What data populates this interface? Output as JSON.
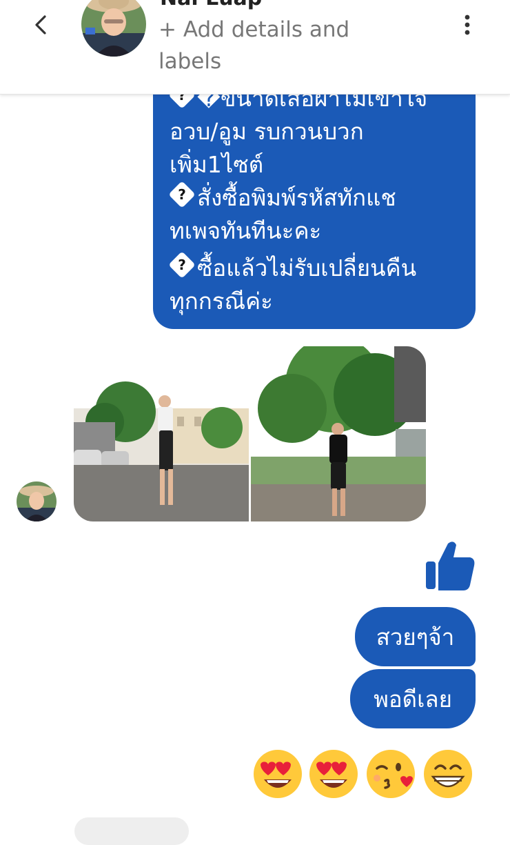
{
  "header": {
    "contact_name": "Nal Luap",
    "add_details": "+ Add details and labels"
  },
  "icons": {
    "back": "chevron-left-icon",
    "more": "more-vertical-icon",
    "like": "thumbs-up-icon"
  },
  "colors": {
    "bubble": "#1B5AB7",
    "like": "#1B5AB7",
    "header_text": "#777777"
  },
  "messages": {
    "outgoing_long": {
      "lines": [
        "�ขนาดเสื้อผ้าไม่เข้าใจ",
        "อวบ/อูม รบกวนบวก",
        "เพิ่ม1ไซต์",
        "สั่งซื้อพิมพ์รหัสทักแช",
        "ทเพจทันทีนะคะ",
        "ซื้อแล้วไม่รับเปลี่ยนคืน",
        "ทุกกรณีค่ะ"
      ]
    },
    "incoming_photos": [
      "photo-standing-parking-lot",
      "photo-standing-under-tree"
    ],
    "reply_1": "สวยๆจ้า",
    "reply_2": "พอดีเลย",
    "emojis": [
      "heart-eyes",
      "heart-eyes",
      "kissing-wink",
      "grinning"
    ]
  }
}
